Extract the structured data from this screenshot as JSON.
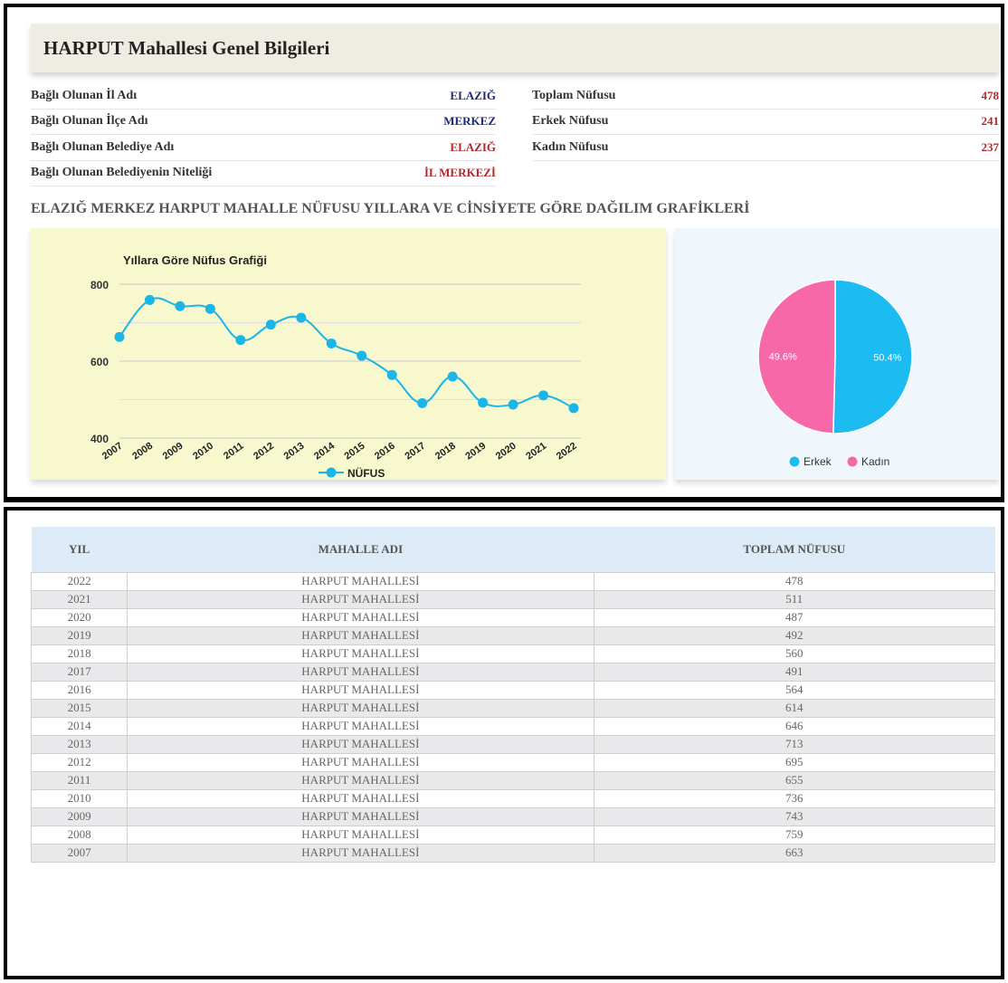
{
  "header": {
    "title": "HARPUT Mahallesi Genel Bilgileri"
  },
  "info_left": [
    {
      "label": "Bağlı Olunan İl Adı",
      "value": "ELAZIĞ",
      "color": "#1d2a7a"
    },
    {
      "label": "Bağlı Olunan İlçe Adı",
      "value": "MERKEZ",
      "color": "#1d2a7a"
    },
    {
      "label": "Bağlı Olunan Belediye Adı",
      "value": "ELAZIĞ",
      "color": "#b3282d"
    },
    {
      "label": "Bağlı Olunan Belediyenin Niteliği",
      "value": "İL MERKEZİ",
      "color": "#b3282d"
    }
  ],
  "info_right": [
    {
      "label": "Toplam Nüfusu",
      "value": "478"
    },
    {
      "label": "Erkek Nüfusu",
      "value": "241"
    },
    {
      "label": "Kadın Nüfusu",
      "value": "237"
    }
  ],
  "section_title": "ELAZIĞ MERKEZ HARPUT MAHALLE NÜFUSU YILLARA VE CİNSİYETE GÖRE DAĞILIM GRAFİKLERİ",
  "chart_data": [
    {
      "type": "line",
      "title": "Yıllara Göre Nüfus Grafiği",
      "x": [
        "2007",
        "2008",
        "2009",
        "2010",
        "2011",
        "2012",
        "2013",
        "2014",
        "2015",
        "2016",
        "2017",
        "2018",
        "2019",
        "2020",
        "2021",
        "2022"
      ],
      "series": [
        {
          "name": "NÜFUS",
          "values": [
            663,
            759,
            743,
            736,
            655,
            695,
            713,
            646,
            614,
            564,
            491,
            560,
            492,
            487,
            511,
            478
          ]
        }
      ],
      "ylim": [
        400,
        800
      ],
      "yticks": [
        "400",
        "600",
        "800"
      ],
      "color": "#1cb5e8",
      "legend": "bottom"
    },
    {
      "type": "pie",
      "categories": [
        "Erkek",
        "Kadın"
      ],
      "values": [
        50.4,
        49.6
      ],
      "labels": [
        "50.4%",
        "49.6%"
      ],
      "colors": [
        "#1cbcf2",
        "#f768a9"
      ],
      "legend": "bottom"
    }
  ],
  "table": {
    "headers": [
      "YIL",
      "MAHALLE ADI",
      "TOPLAM NÜFUSU"
    ],
    "rows": [
      [
        "2022",
        "HARPUT MAHALLESİ",
        "478"
      ],
      [
        "2021",
        "HARPUT MAHALLESİ",
        "511"
      ],
      [
        "2020",
        "HARPUT MAHALLESİ",
        "487"
      ],
      [
        "2019",
        "HARPUT MAHALLESİ",
        "492"
      ],
      [
        "2018",
        "HARPUT MAHALLESİ",
        "560"
      ],
      [
        "2017",
        "HARPUT MAHALLESİ",
        "491"
      ],
      [
        "2016",
        "HARPUT MAHALLESİ",
        "564"
      ],
      [
        "2015",
        "HARPUT MAHALLESİ",
        "614"
      ],
      [
        "2014",
        "HARPUT MAHALLESİ",
        "646"
      ],
      [
        "2013",
        "HARPUT MAHALLESİ",
        "713"
      ],
      [
        "2012",
        "HARPUT MAHALLESİ",
        "695"
      ],
      [
        "2011",
        "HARPUT MAHALLESİ",
        "655"
      ],
      [
        "2010",
        "HARPUT MAHALLESİ",
        "736"
      ],
      [
        "2009",
        "HARPUT MAHALLESİ",
        "743"
      ],
      [
        "2008",
        "HARPUT MAHALLESİ",
        "759"
      ],
      [
        "2007",
        "HARPUT MAHALLESİ",
        "663"
      ]
    ]
  }
}
